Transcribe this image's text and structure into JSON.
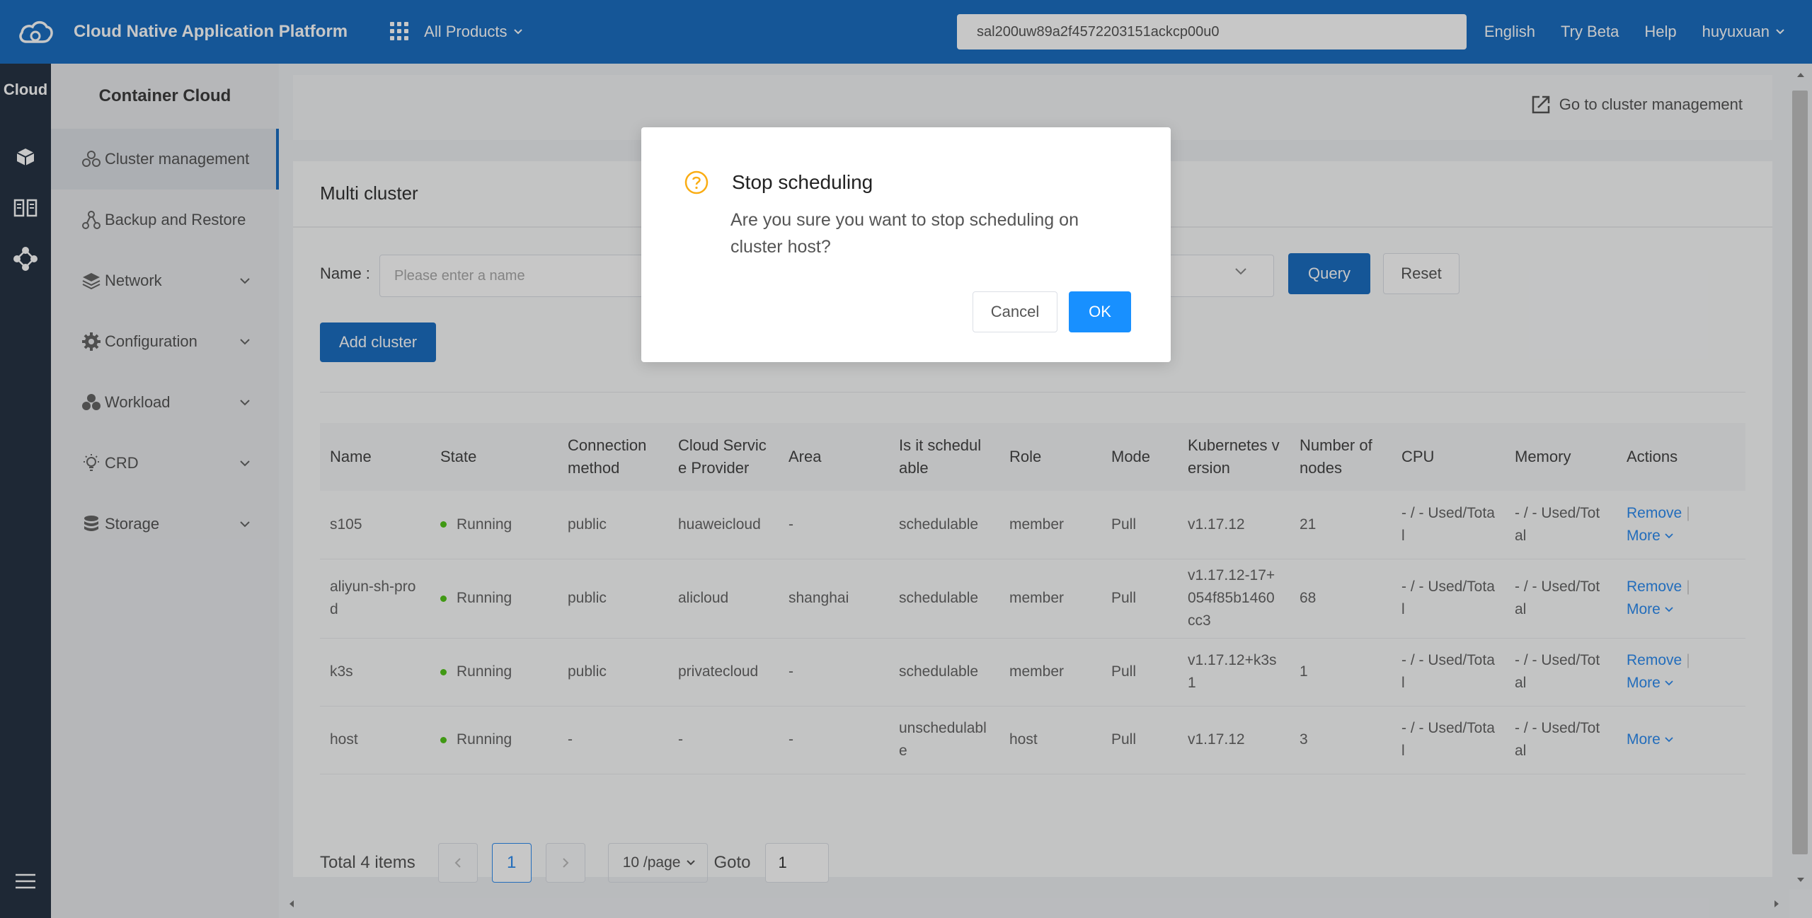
{
  "topbar": {
    "brand": "Cloud Native Application Platform",
    "products_label": "All Products",
    "search_value": "sal200uw89a2f4572203151ackcp00u0",
    "links": [
      "English",
      "Try Beta",
      "Help"
    ],
    "user": "huyuxuan"
  },
  "rail": {
    "title": "Cloud"
  },
  "sidebar": {
    "title": "Container Cloud",
    "items": [
      {
        "label": "Cluster management",
        "icon": "cluster-icon"
      },
      {
        "label": "Backup and Restore",
        "icon": "backup-icon"
      },
      {
        "label": "Network",
        "icon": "network-icon"
      },
      {
        "label": "Configuration",
        "icon": "gear-icon"
      },
      {
        "label": "Workload",
        "icon": "workload-icon"
      },
      {
        "label": "CRD",
        "icon": "bulb-icon"
      },
      {
        "label": "Storage",
        "icon": "database-icon"
      }
    ]
  },
  "header": {
    "goto_cluster": "Go to cluster management"
  },
  "main": {
    "title": "Multi cluster",
    "name_label": "Name :",
    "name_placeholder": "Please enter a name",
    "query_label": "Query",
    "reset_label": "Reset",
    "add_label": "Add cluster"
  },
  "table": {
    "columns": [
      "Name",
      "State",
      "Connection method",
      "Cloud Service Provider",
      "Area",
      "Is it schedulable",
      "Role",
      "Mode",
      "Kubernetes version",
      "Number of nodes",
      "CPU",
      "Memory",
      "Actions"
    ],
    "rows": [
      {
        "name": "s105",
        "state": "Running",
        "conn": "public",
        "provider": "huaweicloud",
        "area": "-",
        "sched": "schedulable",
        "role": "member",
        "mode": "Pull",
        "k8s": "v1.17.12",
        "nodes": "21",
        "cpu": "- / - Used/Total",
        "memory": "- / - Used/Total",
        "remove": "Remove",
        "more": "More"
      },
      {
        "name": "aliyun-sh-prod",
        "state": "Running",
        "conn": "public",
        "provider": "alicloud",
        "area": "shanghai",
        "sched": "schedulable",
        "role": "member",
        "mode": "Pull",
        "k8s": "v1.17.12-17+054f85b1460cc3",
        "nodes": "68",
        "cpu": "- / - Used/Total",
        "memory": "- / - Used/Total",
        "remove": "Remove",
        "more": "More"
      },
      {
        "name": "k3s",
        "state": "Running",
        "conn": "public",
        "provider": "privatecloud",
        "area": "-",
        "sched": "schedulable",
        "role": "member",
        "mode": "Pull",
        "k8s": "v1.17.12+k3s1",
        "nodes": "1",
        "cpu": "- / - Used/Total",
        "memory": "- / - Used/Total",
        "remove": "Remove",
        "more": "More"
      },
      {
        "name": "host",
        "state": "Running",
        "conn": "-",
        "provider": "-",
        "area": "-",
        "sched": "unschedulable",
        "role": "host",
        "mode": "Pull",
        "k8s": "v1.17.12",
        "nodes": "3",
        "cpu": "- / - Used/Total",
        "memory": "- / - Used/Total",
        "remove": "",
        "more": "More"
      }
    ]
  },
  "pager": {
    "total": "Total 4 items",
    "current": "1",
    "page_size": "10 /page",
    "goto_label": "Goto",
    "goto_value": "1"
  },
  "modal": {
    "title": "Stop scheduling",
    "message": "Are you sure you want to stop scheduling on cluster host?",
    "cancel": "Cancel",
    "ok": "OK"
  },
  "colors": {
    "topbar": "#1c6fc2",
    "rail": "#273444",
    "ok_button": "#1890ff",
    "running_dot": "#52c41a",
    "link": "#2d8cf0"
  }
}
